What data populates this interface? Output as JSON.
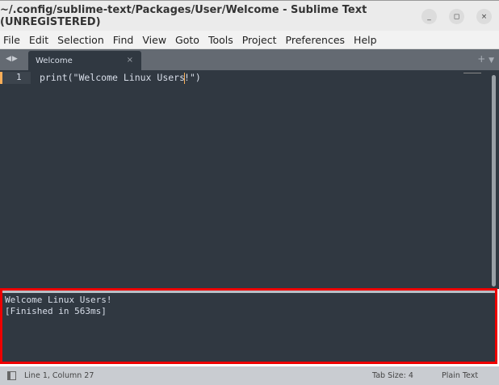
{
  "window": {
    "title": "~/.config/sublime-text/Packages/User/Welcome - Sublime Text (UNREGISTERED)",
    "minimize": "_",
    "maximize": "◻",
    "close": "×"
  },
  "menu": [
    "File",
    "Edit",
    "Selection",
    "Find",
    "View",
    "Goto",
    "Tools",
    "Project",
    "Preferences",
    "Help"
  ],
  "tabs": {
    "nav": "◀▶",
    "active": "Welcome",
    "close": "×",
    "new": "+",
    "dropdown": "▼"
  },
  "editor": {
    "line_number": "1",
    "code_before_caret": "print(\"Welcome Linux Users",
    "code_after_caret": "!\")"
  },
  "output": {
    "lines": [
      "Welcome Linux Users!",
      "[Finished in 563ms]"
    ]
  },
  "status": {
    "position": "Line 1, Column 27",
    "tab_size": "Tab Size: 4",
    "syntax": "Plain Text"
  },
  "colors": {
    "editor_bg": "#303841",
    "highlight": "#e00000",
    "caret": "#f9ae58"
  }
}
